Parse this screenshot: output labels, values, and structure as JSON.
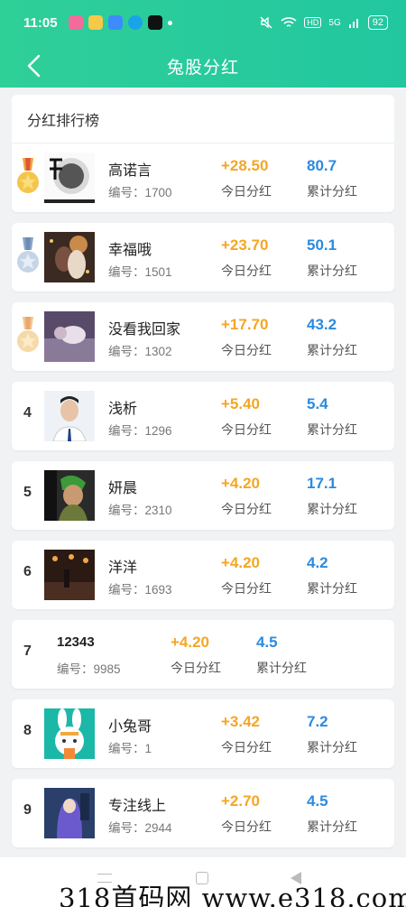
{
  "status": {
    "time": "11:05",
    "battery": "92",
    "network": "5G"
  },
  "nav": {
    "title": "兔股分红"
  },
  "panel": {
    "title": "分红排行榜"
  },
  "colors": {
    "header": "#2fcf98",
    "today": "#f5a623",
    "total": "#2b8ae0"
  },
  "rows": [
    {
      "rank": "",
      "medal": "gold",
      "name": "高诺言",
      "id": "编号：1700",
      "today": "+28.50",
      "today_label": "今日分红",
      "total": "80.7",
      "total_label": "累计分红"
    },
    {
      "rank": "",
      "medal": "silver",
      "name": "幸福哦",
      "id": "编号：1501",
      "today": "+23.70",
      "today_label": "今日分红",
      "total": "50.1",
      "total_label": "累计分红"
    },
    {
      "rank": "",
      "medal": "bronze",
      "name": "没看我回家",
      "id": "编号：1302",
      "today": "+17.70",
      "today_label": "今日分红",
      "total": "43.2",
      "total_label": "累计分红"
    },
    {
      "rank": "4",
      "name": "浅析",
      "id": "编号：1296",
      "today": "+5.40",
      "today_label": "今日分红",
      "total": "5.4",
      "total_label": "累计分红"
    },
    {
      "rank": "5",
      "name": "妍晨",
      "id": "编号：2310",
      "today": "+4.20",
      "today_label": "今日分红",
      "total": "17.1",
      "total_label": "累计分红"
    },
    {
      "rank": "6",
      "name": "洋洋",
      "id": "编号：1693",
      "today": "+4.20",
      "today_label": "今日分红",
      "total": "4.2",
      "total_label": "累计分红"
    },
    {
      "rank": "7",
      "name": "12343",
      "id": "编号：9985",
      "today": "+4.20",
      "today_label": "今日分红",
      "total": "4.5",
      "total_label": "累计分红"
    },
    {
      "rank": "8",
      "name": "小兔哥",
      "id": "编号：1",
      "today": "+3.42",
      "today_label": "今日分红",
      "total": "7.2",
      "total_label": "累计分红"
    },
    {
      "rank": "9",
      "name": "专注线上",
      "id": "编号：2944",
      "today": "+2.70",
      "today_label": "今日分红",
      "total": "4.5",
      "total_label": "累计分红"
    }
  ],
  "watermark": "318首码网  www.e318.com"
}
